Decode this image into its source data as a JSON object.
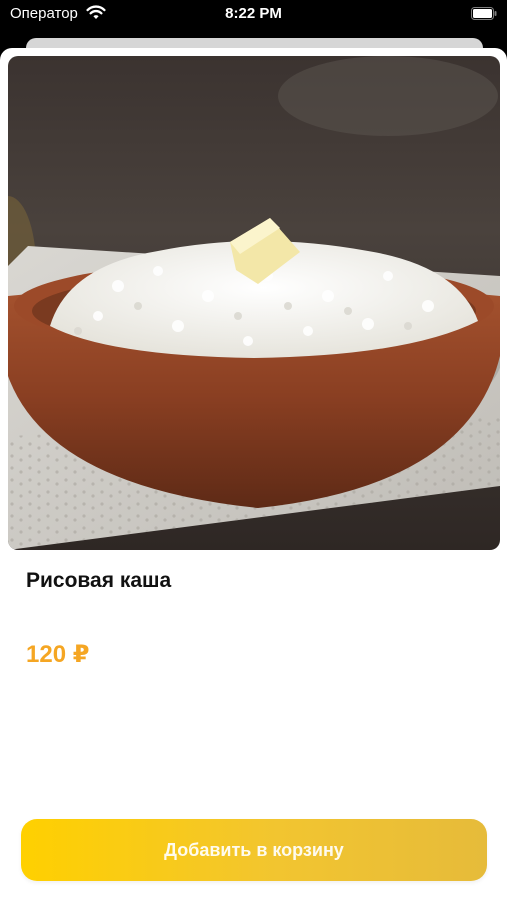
{
  "status_bar": {
    "carrier": "Оператор",
    "time": "8:22 PM",
    "wifi_icon": "wifi-icon",
    "battery_icon": "battery-icon"
  },
  "product": {
    "name": "Рисовая каша",
    "price": "120 ₽",
    "price_color": "#f5a623",
    "image_subject": "rice-porridge-bowl-photo"
  },
  "actions": {
    "add_to_cart_label": "Добавить в корзину",
    "accent_color": "#ffd000"
  }
}
